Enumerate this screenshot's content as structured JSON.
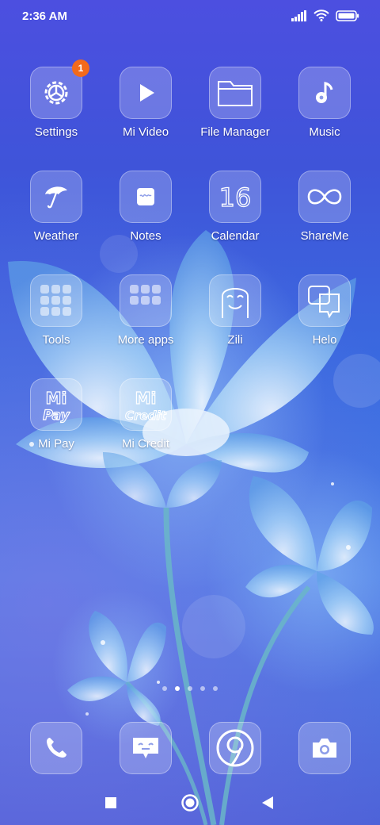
{
  "status_bar": {
    "time": "2:36 AM",
    "icons": [
      "signal-icon",
      "wifi-icon",
      "battery-icon"
    ]
  },
  "apps": [
    {
      "label": "Settings",
      "icon": "gear-icon",
      "badge": "1"
    },
    {
      "label": "Mi Video",
      "icon": "play-icon"
    },
    {
      "label": "File Manager",
      "icon": "folder-icon"
    },
    {
      "label": "Music",
      "icon": "music-note-icon"
    },
    {
      "label": "Weather",
      "icon": "umbrella-icon"
    },
    {
      "label": "Notes",
      "icon": "notes-icon"
    },
    {
      "label": "Calendar",
      "icon": "calendar-icon",
      "day": "16"
    },
    {
      "label": "ShareMe",
      "icon": "infinity-icon"
    },
    {
      "label": "Tools",
      "icon": "tools-grid-icon"
    },
    {
      "label": "More apps",
      "icon": "apps-folder-icon"
    },
    {
      "label": "Zili",
      "icon": "zili-face-icon"
    },
    {
      "label": "Helo",
      "icon": "chat-bubbles-icon"
    },
    {
      "label": "Mi Pay",
      "icon": "mi-pay-icon",
      "logo_top": "Mi",
      "logo_bottom": "Pay"
    },
    {
      "label": "Mi Credit",
      "icon": "mi-credit-icon",
      "logo_top": "Mi",
      "logo_bottom": "Credit"
    }
  ],
  "page_indicator": {
    "count": 5,
    "active_index": 1
  },
  "dock": [
    {
      "icon": "phone-icon"
    },
    {
      "icon": "messages-icon"
    },
    {
      "icon": "browser-icon"
    },
    {
      "icon": "camera-icon"
    }
  ],
  "nav_bar": [
    "recents-button",
    "home-button",
    "back-button"
  ],
  "colors": {
    "badge": "#f26a1b",
    "background_top": "#4c4fe0",
    "background_bottom": "#4d62d8"
  }
}
